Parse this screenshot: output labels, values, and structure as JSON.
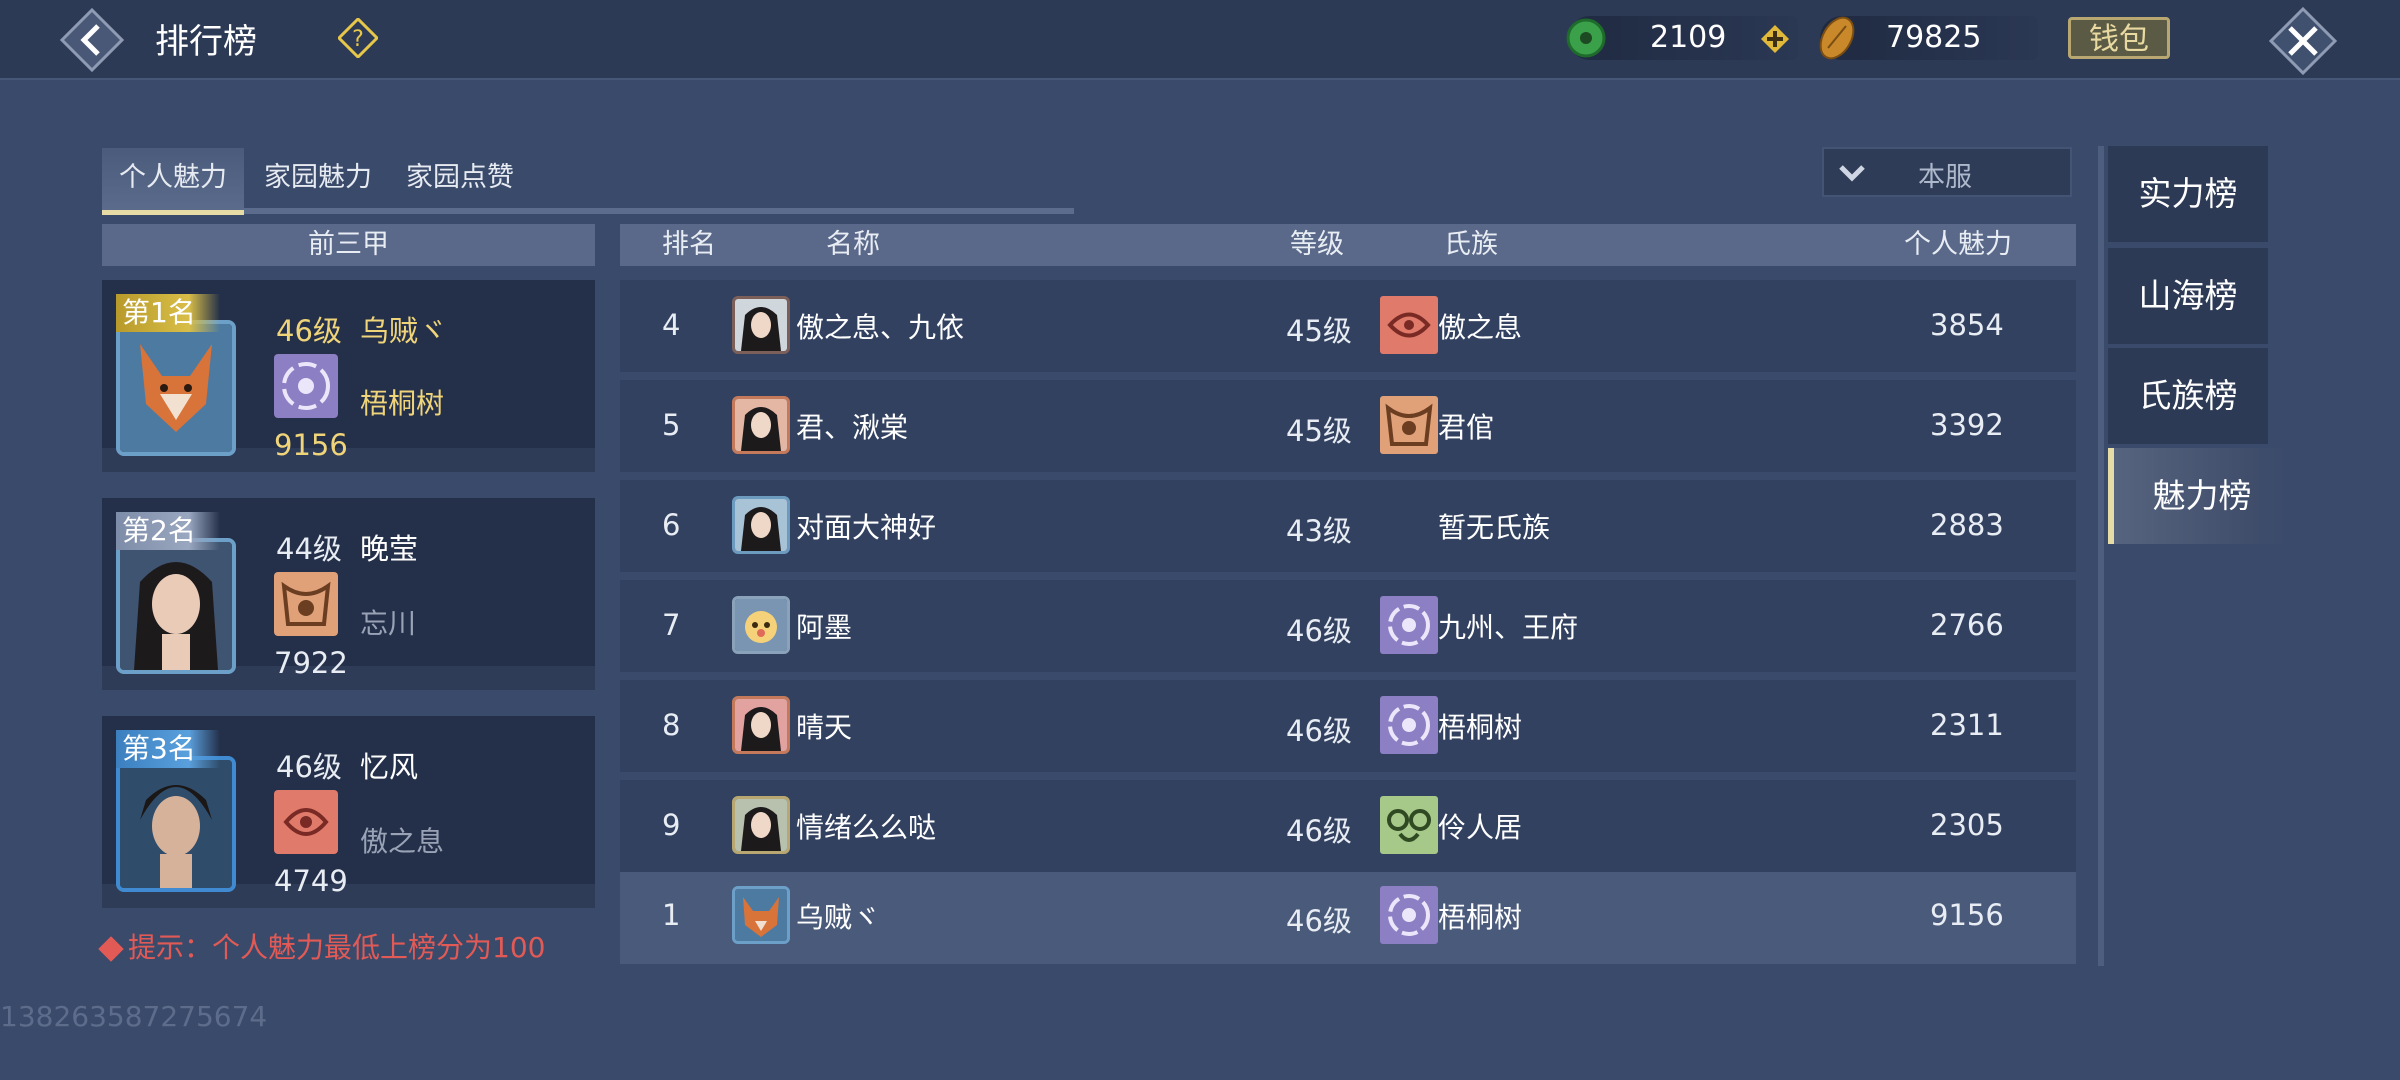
{
  "header": {
    "title": "排行榜",
    "currency_jade": "2109",
    "currency_gold": "79825",
    "wallet_label": "钱包"
  },
  "tabs": [
    "个人魅力",
    "家园魅力",
    "家园点赞"
  ],
  "server_select": "本服",
  "top3": {
    "title": "前三甲",
    "entries": [
      {
        "rank_label": "第1名",
        "level": "46级",
        "name": "乌贼ヾ",
        "clan": "梧桐树",
        "score": "9156"
      },
      {
        "rank_label": "第2名",
        "level": "44级",
        "name": "晚莹",
        "clan": "忘川",
        "score": "7922"
      },
      {
        "rank_label": "第3名",
        "level": "46级",
        "name": "忆风",
        "clan": "傲之息",
        "score": "4749"
      }
    ]
  },
  "list": {
    "columns": {
      "rank": "排名",
      "name": "名称",
      "level": "等级",
      "clan": "氏族",
      "charm": "个人魅力"
    },
    "rows": [
      {
        "rank": "4",
        "name": "傲之息、九依",
        "level": "45级",
        "clan": "傲之息",
        "score": "3854"
      },
      {
        "rank": "5",
        "name": "君、湫棠",
        "level": "45级",
        "clan": "君倌",
        "score": "3392"
      },
      {
        "rank": "6",
        "name": "对面大神好",
        "level": "43级",
        "clan": "暂无氏族",
        "score": "2883"
      },
      {
        "rank": "7",
        "name": "阿墨",
        "level": "46级",
        "clan": "九州、王府",
        "score": "2766"
      },
      {
        "rank": "8",
        "name": "晴天",
        "level": "46级",
        "clan": "梧桐树",
        "score": "2311"
      },
      {
        "rank": "9",
        "name": "情绪么么哒",
        "level": "46级",
        "clan": "伶人居",
        "score": "2305"
      }
    ],
    "self_row": {
      "rank": "1",
      "name": "乌贼ヾ",
      "level": "46级",
      "clan": "梧桐树",
      "score": "9156"
    }
  },
  "side_tabs": [
    "实力榜",
    "山海榜",
    "氏族榜",
    "魅力榜"
  ],
  "tip": "提示：个人魅力最低上榜分为100",
  "uid": "138263587275674",
  "colors": {
    "gold": "#f0d47a",
    "tip_red": "#e25a55",
    "active_tab_accent": "#e8dca6"
  }
}
